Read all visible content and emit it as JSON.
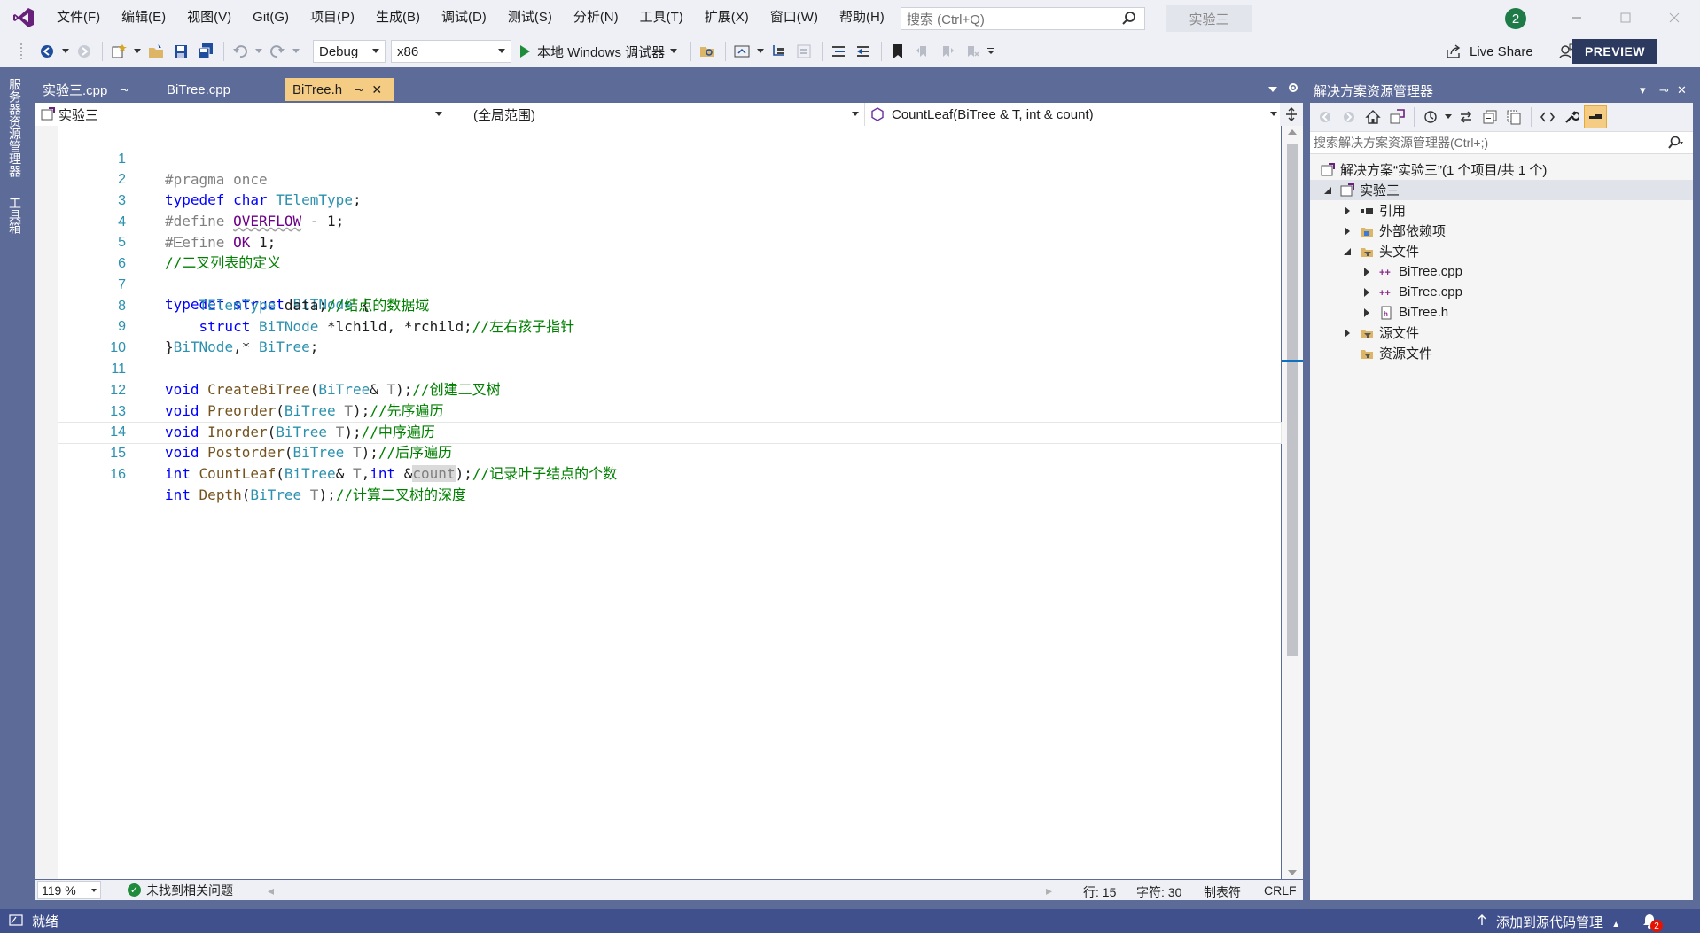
{
  "menu": {
    "items": [
      "文件(F)",
      "编辑(E)",
      "视图(V)",
      "Git(G)",
      "项目(P)",
      "生成(B)",
      "调试(D)",
      "测试(S)",
      "分析(N)",
      "工具(T)",
      "扩展(X)",
      "窗口(W)",
      "帮助(H)"
    ],
    "search_placeholder": "搜索 (Ctrl+Q)",
    "solution_name": "实验三",
    "notification_count": "2"
  },
  "toolbar": {
    "configuration": "Debug",
    "platform": "x86",
    "run_label": "本地 Windows 调试器",
    "live_share": "Live Share",
    "preview": "PREVIEW"
  },
  "left_strip": {
    "server_explorer": "服务器资源管理器",
    "toolbox": "工具箱"
  },
  "doc_tabs": [
    {
      "label": "实验三.cpp",
      "pinned": true,
      "active": false
    },
    {
      "label": "BiTree.cpp",
      "pinned": false,
      "active": false
    },
    {
      "label": "BiTree.h",
      "pinned": true,
      "active": true
    }
  ],
  "nav_bar": {
    "project": "实验三",
    "scope": "(全局范围)",
    "member": "CountLeaf(BiTree & T, int & count)"
  },
  "code_lines": [
    {
      "n": "1",
      "text": "#pragma once"
    },
    {
      "n": "2",
      "text": "typedef char TElemType;"
    },
    {
      "n": "3",
      "text": "#define OVERFLOW - 1;"
    },
    {
      "n": "4",
      "text": "#define OK 1;"
    },
    {
      "n": "5",
      "text": "//二叉列表的定义"
    },
    {
      "n": "6",
      "text": "typedef struct BiTNode {"
    },
    {
      "n": "7",
      "text": "    TElemType data;//结点的数据域"
    },
    {
      "n": "8",
      "text": "    struct BiTNode *lchild, *rchild;//左右孩子指针"
    },
    {
      "n": "9",
      "text": "}BiTNode,* BiTree;"
    },
    {
      "n": "10",
      "text": ""
    },
    {
      "n": "11",
      "text": "void CreateBiTree(BiTree& T);//创建二叉树"
    },
    {
      "n": "12",
      "text": "void Preorder(BiTree T);//先序遍历"
    },
    {
      "n": "13",
      "text": "void Inorder(BiTree T);//中序遍历"
    },
    {
      "n": "14",
      "text": "void Postorder(BiTree T);//后序遍历"
    },
    {
      "n": "15",
      "text": "int CountLeaf(BiTree& T,int &count);//记录叶子结点的个数"
    },
    {
      "n": "16",
      "text": "int Depth(BiTree T);//计算二叉树的深度"
    }
  ],
  "editor_status": {
    "zoom": "119 %",
    "issues": "未找到相关问题",
    "line": "行: 15",
    "char": "字符: 30",
    "indent": "制表符",
    "eol": "CRLF"
  },
  "solution_explorer": {
    "title": "解决方案资源管理器",
    "search_placeholder": "搜索解决方案资源管理器(Ctrl+;)",
    "solution_label": "解决方案“实验三”(1 个项目/共 1 个)",
    "project_label": "实验三",
    "references": "引用",
    "external_deps": "外部依赖项",
    "header_files": "头文件",
    "header_items": [
      "BiTree.cpp",
      "BiTree.cpp",
      "BiTree.h"
    ],
    "source_files": "源文件",
    "resource_files": "资源文件"
  },
  "statusbar": {
    "ready": "就绪",
    "source_control": "添加到源代码管理",
    "notifications": "2"
  },
  "colors": {
    "accent": "#5d6b99",
    "active_tab": "#f5cc84",
    "status_bar": "#40508d",
    "keyword": "#0000ff",
    "type": "#2b91af",
    "comment": "#008000",
    "macro": "#6f008a"
  }
}
